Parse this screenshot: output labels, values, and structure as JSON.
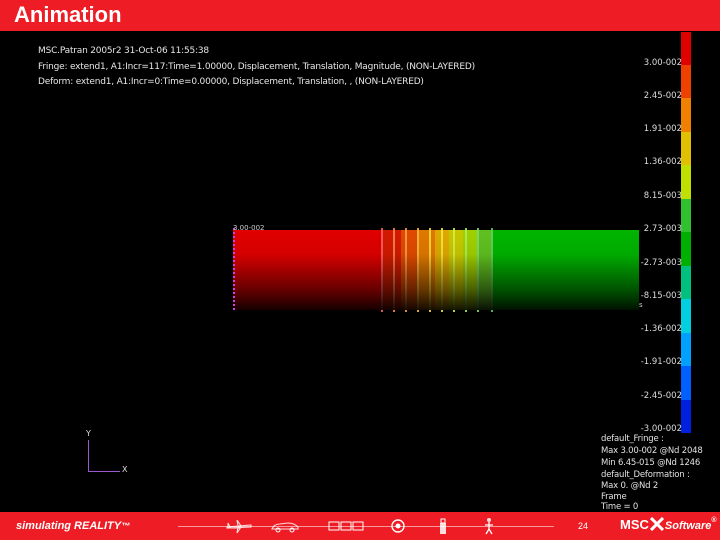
{
  "slide": {
    "title": "Animation",
    "accent_color": "#ee1c24",
    "page_number": "24"
  },
  "viewport": {
    "header_lines": [
      "MSC.Patran 2005r2 31-Oct-06 11:55:38",
      "Fringe: extend1, A1:Incr=117:Time=1.00000, Displacement, Translation, Magnitude, (NON-LAYERED)",
      "Deform: extend1, A1:Incr=0:Time=0.00000, Displacement, Translation, , (NON-LAYERED)"
    ],
    "colorbar_labels": [
      "3.00-002",
      "2.45-002",
      "1.91-002",
      "1.36-002",
      "8.15-003",
      "2.73-003",
      "-2.73-003",
      "-8.15-003",
      "-1.36-002",
      "-1.91-002",
      "-2.45-002",
      "-3.00-002"
    ],
    "colorbar_colors": [
      "#e00000",
      "#f04000",
      "#f08000",
      "#e0c000",
      "#c0e000",
      "#30c030",
      "#00b000",
      "#00c080",
      "#00d0e0",
      "#00a0ff",
      "#0060ff",
      "#0020e0"
    ],
    "node_label": "3.00-002",
    "edge_marker": "s",
    "axes": {
      "y": "Y",
      "x": "X"
    },
    "info_lines": [
      "default_Fringe :",
      "Max 3.00-002 @Nd 2048",
      "Min 6.45-015 @Nd 1246",
      "default_Deformation :",
      "Max 0. @Nd 2",
      "Frame",
      "Time = 0"
    ]
  },
  "footer": {
    "slogan": "simulating REALITY",
    "slogan_mark": "™",
    "brand": "MSC",
    "brand_suffix": "Software",
    "brand_mark": "®",
    "icons": [
      "airplane-icon",
      "car-icon",
      "train-icon",
      "target-icon",
      "spray-can-icon",
      "human-figure-icon"
    ]
  }
}
